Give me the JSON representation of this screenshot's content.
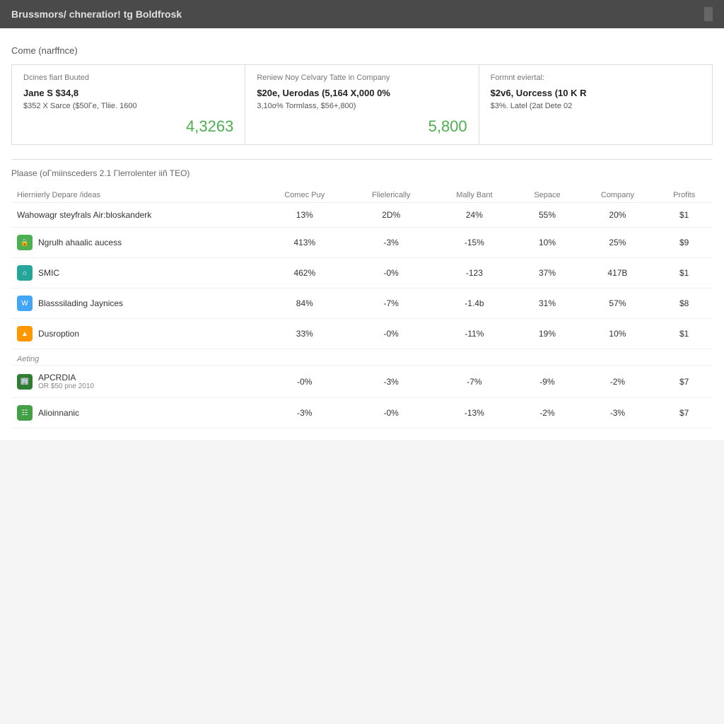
{
  "header": {
    "title": "Brussmors/ chneratior! tg Boldfrosk",
    "right_indicator": ""
  },
  "section_title": "Come (narffnce)",
  "summary_cards": [
    {
      "label": "Dcines fiart Buuted",
      "main_line1": "Jane S $34,8",
      "main_line2": "$352 X Sarce ($50Γe, Tliie. 1600",
      "number": "4,3263"
    },
    {
      "label": "Reniew Noy Celvary Tatte in Company",
      "main_line1": "$20e, Uerodas (5,164 X,000 0%",
      "main_line2": "3,10o% Tormlass, $56+,800)",
      "number": "5,800"
    },
    {
      "label": "Formnt eviertal:",
      "main_line1": "$2v6, Uorcess (10 K R",
      "main_line2": "$3%. Latel (2at Dete 02",
      "number": ""
    }
  ],
  "table_section_title": "Plaase (oΓmiinsceders 2.1 Γlerrolenter iiñ TEO)",
  "columns": [
    "Hiernierly Depare /ideas",
    "Comec Puy",
    "Flielerically",
    "Mally Bant",
    "Sepace",
    "Company",
    "Profits"
  ],
  "table_rows": [
    {
      "type": "row",
      "icon_color": "none",
      "icon_type": "none",
      "name": "Wahowagr steyfrals Air:bloskanderk",
      "name_sub": "",
      "col1": "13%",
      "col2": "2D%",
      "col3": "24%",
      "col4": "55%",
      "col5": "20%",
      "col6": "$1"
    },
    {
      "type": "row",
      "icon_color": "icon-green",
      "icon_type": "lock",
      "name": "Ngrulh ahaalic aucess",
      "name_sub": "",
      "col1": "413%",
      "col2": "-3%",
      "col3": "-15%",
      "col4": "10%",
      "col5": "25%",
      "col6": "$9"
    },
    {
      "type": "row",
      "icon_color": "icon-teal",
      "icon_type": "home",
      "name": "SMIC",
      "name_sub": "",
      "col1": "462%",
      "col2": "-0%",
      "col3": "-123",
      "col4": "37%",
      "col5": "417B",
      "col6": "$1"
    },
    {
      "type": "row",
      "icon_color": "icon-blue",
      "icon_type": "W",
      "name": "Blasssilading Jaynices",
      "name_sub": "",
      "col1": "84%",
      "col2": "-7%",
      "col3": "-1.4b",
      "col4": "31%",
      "col5": "57%",
      "col6": "$8"
    },
    {
      "type": "row",
      "icon_color": "icon-orange",
      "icon_type": "triangle",
      "name": "Dusroption",
      "name_sub": "",
      "col1": "33%",
      "col2": "-0%",
      "col3": "-11%",
      "col4": "19%",
      "col5": "10%",
      "col6": "$1"
    },
    {
      "type": "group",
      "group_label": "Aeting",
      "icon_color": "icon-dark-green",
      "icon_type": "building",
      "name": "APCRDIA",
      "name_sub": "OR $50 pne 2010",
      "col1": "-0%",
      "col2": "-3%",
      "col3": "-7%",
      "col4": "-9%",
      "col5": "-2%",
      "col6": "$7"
    },
    {
      "type": "row",
      "icon_color": "icon-green2",
      "icon_type": "grid",
      "name": "Alioinnanic",
      "name_sub": "",
      "col1": "-3%",
      "col2": "-0%",
      "col3": "-13%",
      "col4": "-2%",
      "col5": "-3%",
      "col6": "$7"
    }
  ]
}
